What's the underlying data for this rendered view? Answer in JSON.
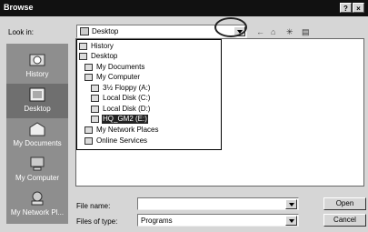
{
  "window": {
    "title": "Browse",
    "help_glyph": "?",
    "close_glyph": "×"
  },
  "lookin": {
    "label": "Look in:",
    "value": "Desktop"
  },
  "toolbar": {
    "back_glyph": "←",
    "up_glyph": "⌂",
    "newfolder_glyph": "✳",
    "views_glyph": "▤"
  },
  "places": [
    {
      "label": "History",
      "icon": "history-icon"
    },
    {
      "label": "Desktop",
      "icon": "desktop-icon",
      "selected": true
    },
    {
      "label": "My Documents",
      "icon": "documents-icon"
    },
    {
      "label": "My Computer",
      "icon": "computer-icon"
    },
    {
      "label": "My Network Pl...",
      "icon": "network-icon"
    }
  ],
  "dropdown": {
    "items": [
      {
        "label": "History",
        "icon": "history-icon"
      },
      {
        "label": "Desktop",
        "icon": "desktop-icon"
      },
      {
        "label": "My Documents",
        "icon": "folder-icon"
      },
      {
        "label": "My Computer",
        "icon": "computer-icon"
      },
      {
        "label": "3½ Floppy (A:)",
        "icon": "floppy-icon"
      },
      {
        "label": "Local Disk (C:)",
        "icon": "disk-icon"
      },
      {
        "label": "Local Disk (D:)",
        "icon": "disk-icon"
      },
      {
        "label": "HQ_GM2 (E:)",
        "icon": "cdrom-icon",
        "selected": true
      },
      {
        "label": "My Network Places",
        "icon": "network-icon"
      },
      {
        "label": "Online Services",
        "icon": "folder-icon"
      }
    ]
  },
  "filename": {
    "label": "File name:",
    "value": ""
  },
  "filetype": {
    "label": "Files of type:",
    "value": "Programs"
  },
  "buttons": {
    "open": "Open",
    "cancel": "Cancel"
  }
}
